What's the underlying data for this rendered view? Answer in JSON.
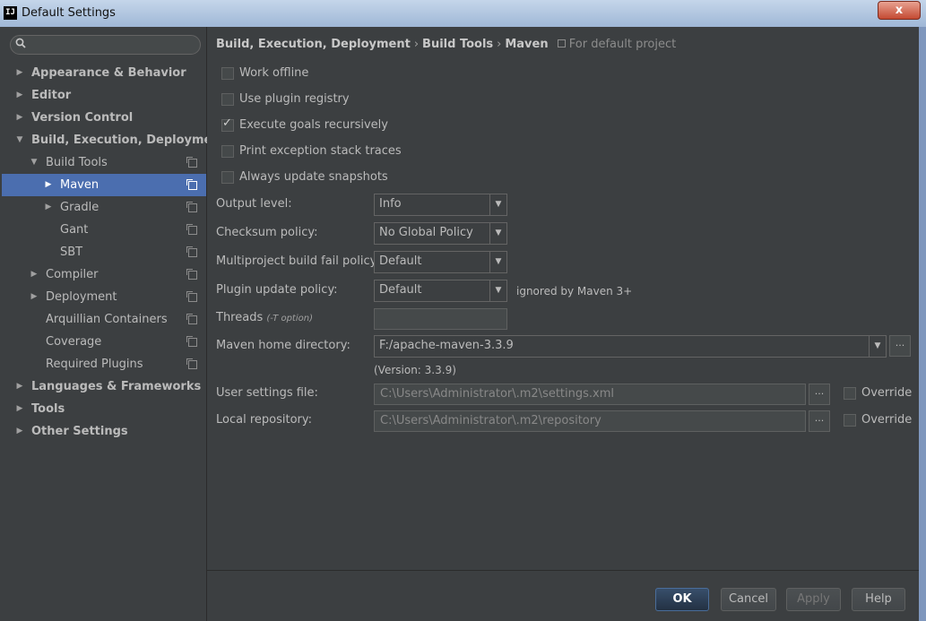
{
  "window": {
    "title": "Default Settings",
    "app_icon": "IJ",
    "close_label": "x"
  },
  "search": {
    "placeholder": ""
  },
  "sidebar": {
    "items": [
      {
        "label": "Appearance & Behavior"
      },
      {
        "label": "Editor"
      },
      {
        "label": "Version Control"
      },
      {
        "label": "Build, Execution, Deployment"
      },
      {
        "label": "Build Tools"
      },
      {
        "label": "Maven"
      },
      {
        "label": "Gradle"
      },
      {
        "label": "Gant"
      },
      {
        "label": "SBT"
      },
      {
        "label": "Compiler"
      },
      {
        "label": "Deployment"
      },
      {
        "label": "Arquillian Containers"
      },
      {
        "label": "Coverage"
      },
      {
        "label": "Required Plugins"
      },
      {
        "label": "Languages & Frameworks"
      },
      {
        "label": "Tools"
      },
      {
        "label": "Other Settings"
      }
    ]
  },
  "breadcrumb": {
    "part1": "Build, Execution, Deployment",
    "part2": "Build Tools",
    "part3": "Maven",
    "separator": "›",
    "scope": "For default project"
  },
  "options": {
    "work_offline": {
      "label": "Work offline",
      "checked": false
    },
    "use_plugin_registry": {
      "label": "Use plugin registry",
      "checked": false
    },
    "execute_goals_recursively": {
      "label": "Execute goals recursively",
      "checked": true
    },
    "print_exception_stack_traces": {
      "label": "Print exception stack traces",
      "checked": false
    },
    "always_update_snapshots": {
      "label": "Always update snapshots",
      "checked": false
    }
  },
  "form": {
    "output_level": {
      "label": "Output level:",
      "value": "Info"
    },
    "checksum_policy": {
      "label": "Checksum policy:",
      "value": "No Global Policy"
    },
    "multiproject_fail_policy": {
      "label": "Multiproject build fail policy:",
      "value": "Default"
    },
    "plugin_update_policy": {
      "label": "Plugin update policy:",
      "value": "Default",
      "note": "ignored by Maven 3+"
    },
    "threads": {
      "label": "Threads",
      "hint": "(-T option)",
      "value": ""
    },
    "maven_home": {
      "label": "Maven home directory:",
      "value": "F:/apache-maven-3.3.9",
      "version": "(Version: 3.3.9)"
    },
    "user_settings_file": {
      "label": "User settings file:",
      "value": "C:\\Users\\Administrator\\.m2\\settings.xml",
      "override_label": "Override"
    },
    "local_repository": {
      "label": "Local repository:",
      "value": "C:\\Users\\Administrator\\.m2\\repository",
      "override_label": "Override"
    },
    "browse_label": "..."
  },
  "buttons": {
    "ok": "OK",
    "cancel": "Cancel",
    "apply": "Apply",
    "help": "Help"
  },
  "colors": {
    "background": "#3c3f41",
    "selection": "#4b6eaf",
    "text": "#bbbbbb"
  }
}
